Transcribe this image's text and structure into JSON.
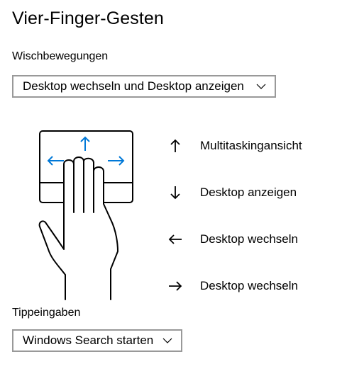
{
  "page": {
    "title": "Vier-Finger-Gesten"
  },
  "swipes": {
    "label": "Wischbewegungen",
    "selected": "Desktop wechseln und Desktop anzeigen",
    "legend": [
      {
        "icon": "arrow-up-icon",
        "text": "Multitaskingansicht"
      },
      {
        "icon": "arrow-down-icon",
        "text": "Desktop anzeigen"
      },
      {
        "icon": "arrow-left-icon",
        "text": "Desktop wechseln"
      },
      {
        "icon": "arrow-right-icon",
        "text": "Desktop wechseln"
      }
    ]
  },
  "taps": {
    "label": "Tippeingaben",
    "selected": "Windows Search starten"
  },
  "colors": {
    "accent": "#0078d7",
    "border": "#999999",
    "text": "#000000"
  }
}
